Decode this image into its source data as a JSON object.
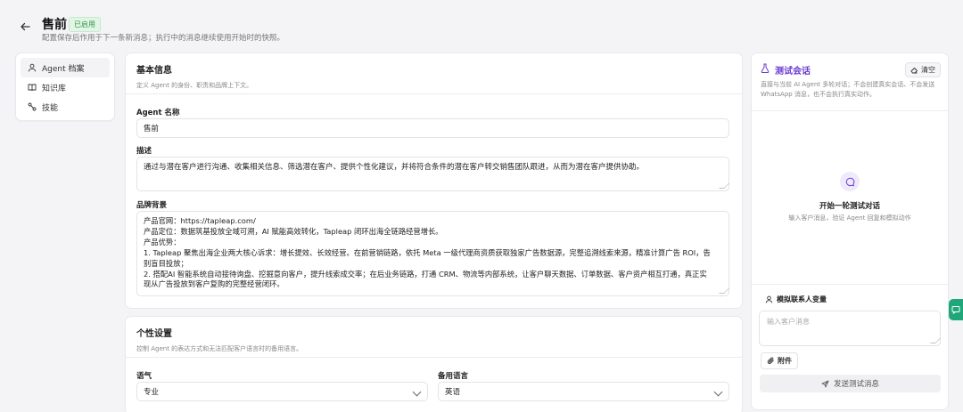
{
  "header": {
    "title": "售前",
    "status_badge": "已启用",
    "subtitle": "配置保存后作用于下一条新消息；执行中的消息继续使用开始时的快照。"
  },
  "nav": {
    "items": [
      {
        "label": "Agent 档案",
        "icon": "user-icon",
        "active": true
      },
      {
        "label": "知识库",
        "icon": "book-icon",
        "active": false
      },
      {
        "label": "技能",
        "icon": "link-icon",
        "active": false
      }
    ]
  },
  "basic_info": {
    "title": "基本信息",
    "description": "定义 Agent 的身份、职责和品牌上下文。",
    "agent_name_label": "Agent 名称",
    "agent_name_value": "售前",
    "desc_label": "描述",
    "desc_value": "通过与潜在客户进行沟通、收集相关信息、筛选潜在客户、提供个性化建议，并将符合条件的潜在客户转交销售团队跟进，从而为潜在客户提供协助。",
    "brand_label": "品牌背景",
    "brand_lines": [
      "产品官网：https://tapleap.com/",
      "产品定位：数据筑基投放全域可溯，AI 赋能高效转化，Tapleap 闭环出海全链路经营增长。",
      "产品优势：",
      "1. Tapleap 聚焦出海企业两大核心诉求：增长提效、长效经营。在前营销链路，依托 Meta 一级代理商资质获取独家广告数据源，完整追溯线索来源，精准计算广告 ROI，告",
      "别盲目投放；",
      "2. 搭配AI 智能系统自动接待询盘、挖掘意向客户，提升线索成交率；在后业务链路，打通 CRM、物流等内部系统，让客户聊天数据、订单数据、客户资产相互打通，真正实",
      "现从广告投放到客户复购的完整经营闭环。"
    ]
  },
  "personality": {
    "title": "个性设置",
    "description": "控制 Agent 的表达方式和无法匹配客户语言时的备用语言。",
    "tone_label": "语气",
    "tone_value": "专业",
    "fallback_label": "备用语言",
    "fallback_value": "英语"
  },
  "test_panel": {
    "title": "测试会话",
    "clear_label": "清空",
    "description": "直接与当前 AI Agent 多轮对话；不会创建真实会话、不会发送 WhatsApp 消息，也不会执行真实动作。",
    "empty_title": "开始一轮测试对话",
    "empty_subtitle": "输入客户消息，验证 Agent 回复和模拟动作",
    "vars_label": "模拟联系人变量",
    "input_placeholder": "输入客户消息",
    "attach_label": "附件",
    "send_label": "发送测试消息"
  },
  "colors": {
    "accent": "#6a3bd1",
    "badge_green": "#2e9a45",
    "float_green": "#1ea87a"
  }
}
